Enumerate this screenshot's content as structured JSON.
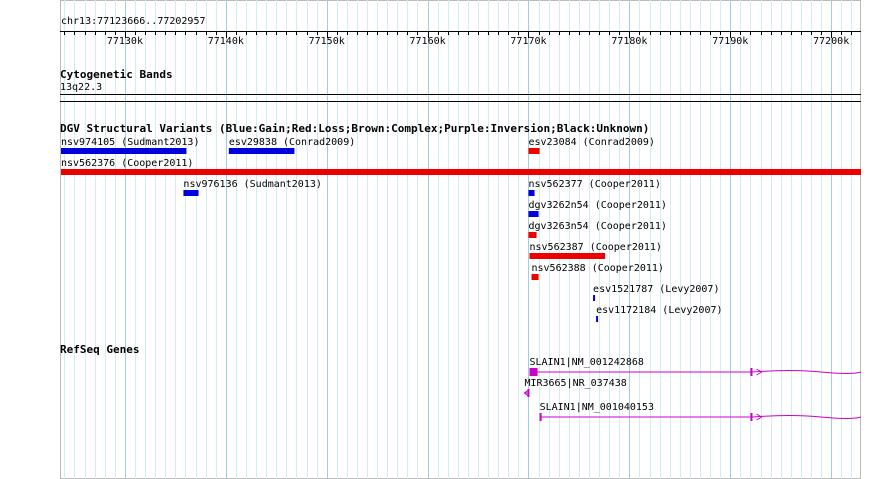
{
  "locus": "chr13:77123666..77202957",
  "ruler": {
    "start": 77123666,
    "end": 77202957,
    "ticks": [
      "77130k",
      "77140k",
      "77150k",
      "77160k",
      "77170k",
      "77180k",
      "77190k",
      "77200k"
    ],
    "tick_values": [
      77130000,
      77140000,
      77150000,
      77160000,
      77170000,
      77180000,
      77190000,
      77200000
    ]
  },
  "tracks": {
    "cytoband": {
      "title": "Cytogenetic Bands",
      "band": "13q22.3"
    },
    "dgv": {
      "title": "DGV Structural Variants (Blue:Gain;Red:Loss;Brown:Complex;Purple:Inversion;Black:Unknown)",
      "features": [
        {
          "id": "f1",
          "label": "nsv974105 (Sudmant2013)",
          "color": "#0000dd",
          "start": 77123666,
          "end": 77136100,
          "row": 0
        },
        {
          "id": "f2",
          "label": "esv29838 (Conrad2009)",
          "color": "#0000dd",
          "start": 77140300,
          "end": 77146800,
          "row": 0
        },
        {
          "id": "f3",
          "label": "esv23084 (Conrad2009)",
          "color": "#ee0000",
          "start": 77170000,
          "end": 77171100,
          "row": 0
        },
        {
          "id": "f4",
          "label": "nsv562376 (Cooper2011)",
          "color": "#ee0000",
          "start": 77123666,
          "end": 77202957,
          "row": 1
        },
        {
          "id": "f5",
          "label": "nsv976136 (Sudmant2013)",
          "color": "#0000dd",
          "start": 77135800,
          "end": 77137300,
          "row": 2
        },
        {
          "id": "f6",
          "label": "nsv562377 (Cooper2011)",
          "color": "#0000dd",
          "start": 77170000,
          "end": 77170600,
          "row": 2
        },
        {
          "id": "f7",
          "label": "dgv3262n54 (Cooper2011)",
          "color": "#0000dd",
          "start": 77170000,
          "end": 77171000,
          "row": 3
        },
        {
          "id": "f8",
          "label": "dgv3263n54 (Cooper2011)",
          "color": "#ee0000",
          "start": 77170000,
          "end": 77170800,
          "row": 4
        },
        {
          "id": "f9",
          "label": "nsv562387 (Cooper2011)",
          "color": "#ee0000",
          "start": 77170100,
          "end": 77177600,
          "row": 5
        },
        {
          "id": "f10",
          "label": "nsv562388 (Cooper2011)",
          "color": "#ee0000",
          "start": 77170300,
          "end": 77171000,
          "row": 6
        },
        {
          "id": "f11",
          "label": "esv1521787 (Levy2007)",
          "color": "#0000dd",
          "start": 77176400,
          "end": 77176550,
          "row": 7
        },
        {
          "id": "f12",
          "label": "esv1172184 (Levy2007)",
          "color": "#0000dd",
          "start": 77176700,
          "end": 77176850,
          "row": 8
        }
      ]
    },
    "refseq": {
      "title": "RefSeq Genes",
      "color": "#cc00cc",
      "genes": [
        {
          "id": "g1",
          "label": "SLAIN1|NM_001242868",
          "strand": "+",
          "row": 0,
          "start": 77170100,
          "end": 77202957,
          "exons": [
            [
              77170100,
              77170900
            ],
            [
              77192000,
              77192200
            ]
          ]
        },
        {
          "id": "g2",
          "label": "MIR3665|NR_037438",
          "strand": "-",
          "row": 1,
          "start": 77169600,
          "end": 77170100,
          "exons": [
            [
              77169900,
              77170050
            ]
          ]
        },
        {
          "id": "g3",
          "label": "SLAIN1|NM_001040153",
          "strand": "+",
          "row": 2,
          "start": 77171100,
          "end": 77202957,
          "exons": [
            [
              77171100,
              77171300
            ],
            [
              77192000,
              77192200
            ]
          ]
        }
      ]
    }
  }
}
